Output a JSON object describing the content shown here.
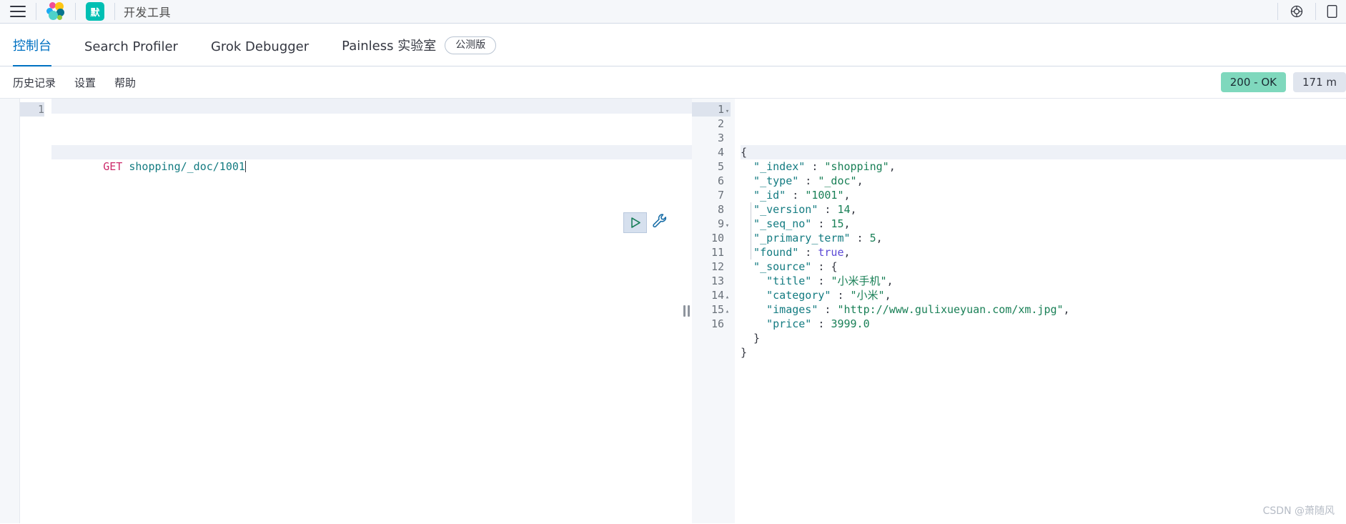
{
  "header": {
    "menu_icon": "hamburger-menu-icon",
    "logo_icon": "elastic-logo-icon",
    "space_badge": "默",
    "app_title": "开发工具",
    "help_icon": "lifebuoy-help-icon",
    "notebook_icon": "document-icon"
  },
  "tabs": [
    {
      "label": "控制台",
      "active": true,
      "badge": null
    },
    {
      "label": "Search Profiler",
      "active": false,
      "badge": null
    },
    {
      "label": "Grok Debugger",
      "active": false,
      "badge": null
    },
    {
      "label": "Painless 实验室",
      "active": false,
      "badge": "公测版"
    }
  ],
  "submenu": {
    "items": [
      {
        "label": "历史记录"
      },
      {
        "label": "设置"
      },
      {
        "label": "帮助"
      }
    ],
    "status_code": "200 - OK",
    "status_time": "171 m"
  },
  "editor": {
    "line_numbers": [
      "1"
    ],
    "request_method": "GET",
    "request_path": "shopping/_doc/1001",
    "play_icon": "play-triangle-icon",
    "wrench_icon": "wrench-icon",
    "splitter_icon": "drag-handle-icon"
  },
  "response": {
    "line_numbers": [
      "1",
      "2",
      "3",
      "4",
      "5",
      "6",
      "7",
      "8",
      "9",
      "10",
      "11",
      "12",
      "13",
      "14",
      "15",
      "16"
    ],
    "fold_markers": {
      "1": "▾",
      "9": "▾",
      "14": "▴",
      "15": "▴"
    },
    "lines": [
      [
        {
          "t": "{",
          "c": "punct"
        }
      ],
      [
        {
          "t": "  \"_index\"",
          "c": "key"
        },
        {
          "t": " : ",
          "c": "punct"
        },
        {
          "t": "\"shopping\"",
          "c": "str"
        },
        {
          "t": ",",
          "c": "punct"
        }
      ],
      [
        {
          "t": "  \"_type\"",
          "c": "key"
        },
        {
          "t": " : ",
          "c": "punct"
        },
        {
          "t": "\"_doc\"",
          "c": "str"
        },
        {
          "t": ",",
          "c": "punct"
        }
      ],
      [
        {
          "t": "  \"_id\"",
          "c": "key"
        },
        {
          "t": " : ",
          "c": "punct"
        },
        {
          "t": "\"1001\"",
          "c": "str"
        },
        {
          "t": ",",
          "c": "punct"
        }
      ],
      [
        {
          "t": "  \"_version\"",
          "c": "key"
        },
        {
          "t": " : ",
          "c": "punct"
        },
        {
          "t": "14",
          "c": "num"
        },
        {
          "t": ",",
          "c": "punct"
        }
      ],
      [
        {
          "t": "  \"_seq_no\"",
          "c": "key"
        },
        {
          "t": " : ",
          "c": "punct"
        },
        {
          "t": "15",
          "c": "num"
        },
        {
          "t": ",",
          "c": "punct"
        }
      ],
      [
        {
          "t": "  \"_primary_term\"",
          "c": "key"
        },
        {
          "t": " : ",
          "c": "punct"
        },
        {
          "t": "5",
          "c": "num"
        },
        {
          "t": ",",
          "c": "punct"
        }
      ],
      [
        {
          "t": "  \"found\"",
          "c": "key"
        },
        {
          "t": " : ",
          "c": "punct"
        },
        {
          "t": "true",
          "c": "bool"
        },
        {
          "t": ",",
          "c": "punct"
        }
      ],
      [
        {
          "t": "  \"_source\"",
          "c": "key"
        },
        {
          "t": " : ",
          "c": "punct"
        },
        {
          "t": "{",
          "c": "punct"
        }
      ],
      [
        {
          "t": "    \"title\"",
          "c": "key"
        },
        {
          "t": " : ",
          "c": "punct"
        },
        {
          "t": "\"小米手机\"",
          "c": "str"
        },
        {
          "t": ",",
          "c": "punct"
        }
      ],
      [
        {
          "t": "    \"category\"",
          "c": "key"
        },
        {
          "t": " : ",
          "c": "punct"
        },
        {
          "t": "\"小米\"",
          "c": "str"
        },
        {
          "t": ",",
          "c": "punct"
        }
      ],
      [
        {
          "t": "    \"images\"",
          "c": "key"
        },
        {
          "t": " : ",
          "c": "punct"
        },
        {
          "t": "\"http://www.gulixueyuan.com/xm.jpg\"",
          "c": "str"
        },
        {
          "t": ",",
          "c": "punct"
        }
      ],
      [
        {
          "t": "    \"price\"",
          "c": "key"
        },
        {
          "t": " : ",
          "c": "punct"
        },
        {
          "t": "3999.0",
          "c": "num"
        }
      ],
      [
        {
          "t": "  }",
          "c": "punct"
        }
      ],
      [
        {
          "t": "}",
          "c": "punct"
        }
      ],
      [
        {
          "t": "",
          "c": "punct"
        }
      ]
    ]
  },
  "watermark": "CSDN @萧随风",
  "colors": {
    "accent": "#0071c2",
    "teal": "#00bfb3",
    "status_ok_bg": "#7fd8bd",
    "status_time_bg": "#e0e5ee",
    "header_bg": "#f5f7fa",
    "border": "#d3dae6"
  }
}
